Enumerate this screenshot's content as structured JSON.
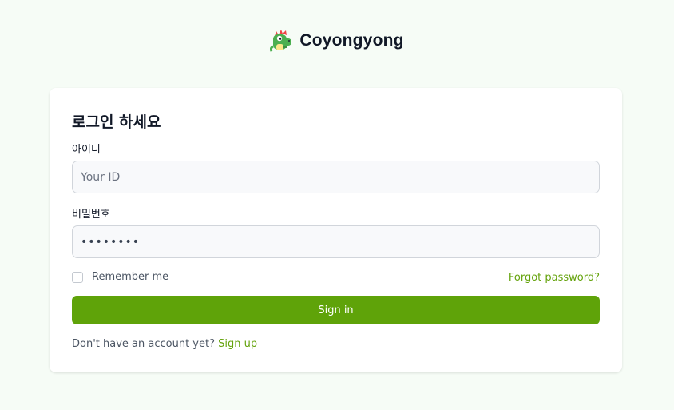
{
  "brand": {
    "logo_icon": "dragon-mascot-icon",
    "name": "Coyongyong"
  },
  "login": {
    "title": "로그인 하세요",
    "id_label": "아이디",
    "id_placeholder": "Your ID",
    "id_value": "",
    "password_label": "비밀번호",
    "password_value": "password",
    "remember_label": "Remember me",
    "remember_checked": false,
    "forgot_label": "Forgot password?",
    "signin_label": "Sign in",
    "signup_prompt": "Don't have an account yet?",
    "signup_label": "Sign up"
  },
  "colors": {
    "page_background": "#f6fcf6",
    "primary": "#5fa309",
    "link": "#65a30d"
  }
}
